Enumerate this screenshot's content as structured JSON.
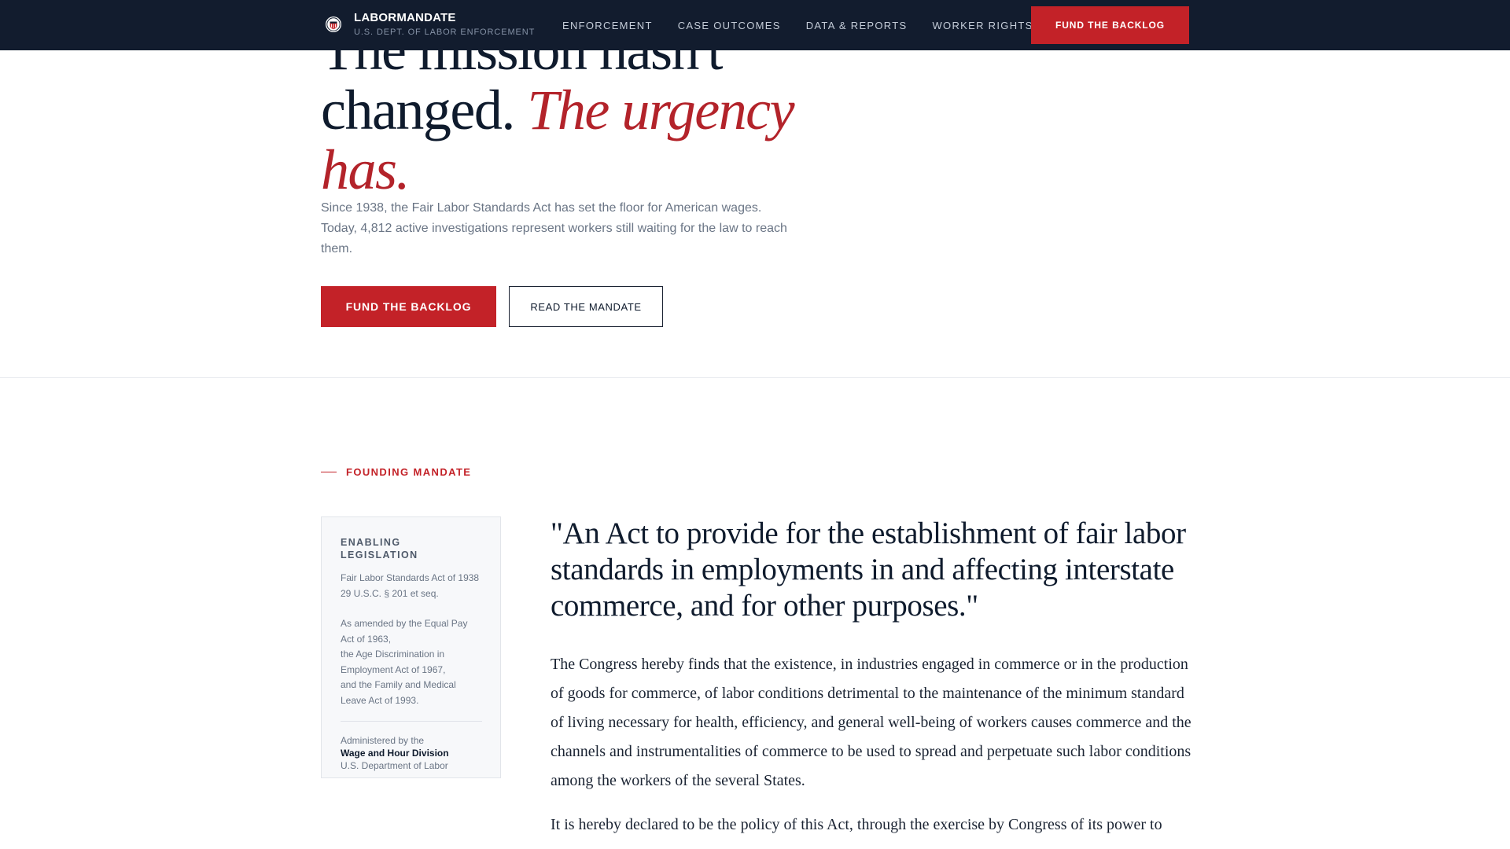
{
  "nav": {
    "brand_name": "LABORMANDATE",
    "brand_sub": "U.S. DEPT. OF LABOR ENFORCEMENT",
    "brand_icon": "seal-icon",
    "links": [
      "ENFORCEMENT",
      "CASE OUTCOMES",
      "DATA & REPORTS",
      "WORKER RIGHTS"
    ],
    "cta_label": "FUND THE BACKLOG"
  },
  "hero": {
    "title_line1": "The mission hasn't",
    "title_line2_plain": "changed. ",
    "title_line2_accent": "The urgency",
    "title_line3_accent": "has.",
    "description": "Since 1938, the Fair Labor Standards Act has set the floor for American wages. Today, 4,812 active investigations represent workers still waiting for the law to reach them.",
    "primary_button": "FUND THE BACKLOG",
    "secondary_button": "READ THE MANDATE"
  },
  "mandate": {
    "eyebrow": "FOUNDING MANDATE",
    "sidebar": {
      "heading": "ENABLING LEGISLATION",
      "act_line1": "Fair Labor Standards Act of 1938",
      "act_line2": "29 U.S.C. § 201 et seq.",
      "amend_line1": "As amended by the Equal Pay Act of 1963,",
      "amend_line2": "the Age Discrimination in Employment Act of 1967,",
      "amend_line3": "and the Family and Medical Leave Act of 1993.",
      "admin_label": "Administered by the",
      "admin_division": "Wage and Hour Division",
      "admin_dept": "U.S. Department of Labor"
    },
    "quote": "\"An Act to provide for the establishment of fair labor standards in employments in and affecting interstate commerce, and for other purposes.\"",
    "paragraph_1": "The Congress hereby finds that the existence, in industries engaged in commerce or in the production of goods for commerce, of labor conditions detrimental to the maintenance of the minimum standard of living necessary for health, efficiency, and general well-being of workers causes commerce and the channels and instrumentalities of commerce to be used to spread and perpetuate such labor conditions among the workers of the several States.",
    "paragraph_2": "It is hereby declared to be the policy of this Act, through the exercise by Congress of its power to"
  },
  "colors": {
    "nav_bg": "#121c2e",
    "accent_red": "#c32228",
    "ink": "#0f1b2d",
    "muted": "#6a7585"
  }
}
